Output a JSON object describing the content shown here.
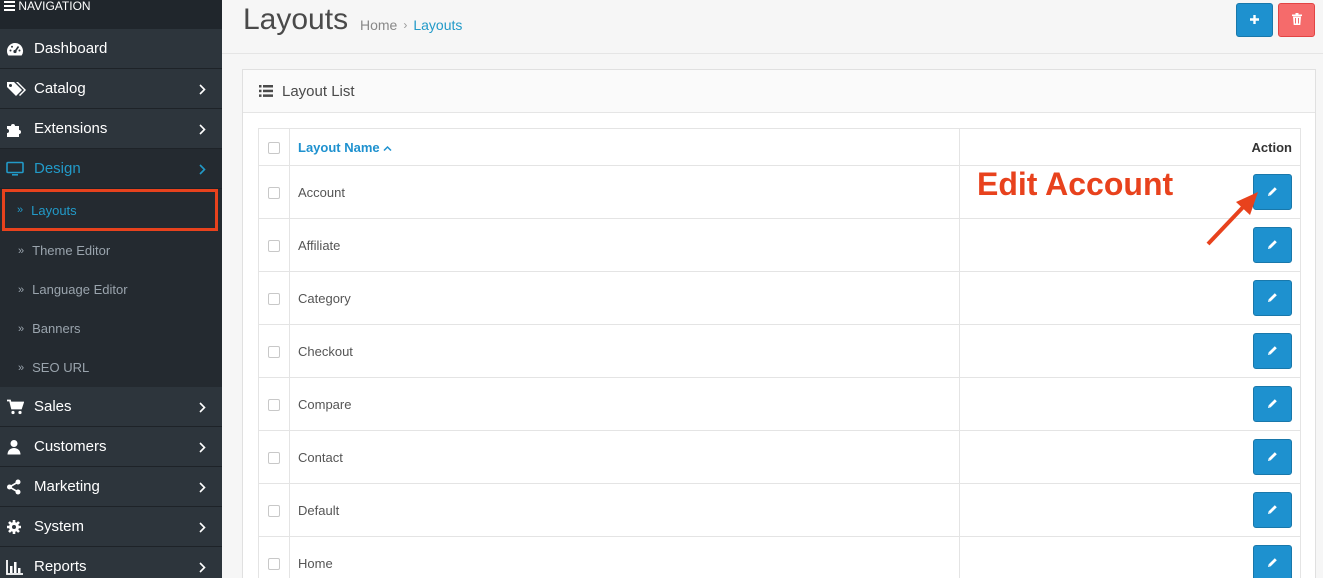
{
  "sidebar": {
    "header": "NAVIGATION",
    "items": [
      {
        "label": "Dashboard",
        "icon": "dashboard-icon"
      },
      {
        "label": "Catalog",
        "icon": "tags-icon"
      },
      {
        "label": "Extensions",
        "icon": "puzzle-icon"
      },
      {
        "label": "Design",
        "icon": "monitor-icon"
      },
      {
        "label": "Sales",
        "icon": "cart-icon"
      },
      {
        "label": "Customers",
        "icon": "user-icon"
      },
      {
        "label": "Marketing",
        "icon": "share-icon"
      },
      {
        "label": "System",
        "icon": "gear-icon"
      },
      {
        "label": "Reports",
        "icon": "bar-chart-icon"
      }
    ],
    "design_sub": [
      "Layouts",
      "Theme Editor",
      "Language Editor",
      "Banners",
      "SEO URL"
    ]
  },
  "header": {
    "title": "Layouts",
    "breadcrumb_home": "Home",
    "breadcrumb_current": "Layouts"
  },
  "panel": {
    "title": "Layout List",
    "col_name": "Layout Name",
    "col_action": "Action",
    "rows": [
      "Account",
      "Affiliate",
      "Category",
      "Checkout",
      "Compare",
      "Contact",
      "Default",
      "Home"
    ]
  },
  "annotation": "Edit Account",
  "colors": {
    "sidebar_bg": "#2d353c",
    "accent": "#1e91cf",
    "danger": "#f56b6b",
    "annotation": "#e8421d"
  }
}
